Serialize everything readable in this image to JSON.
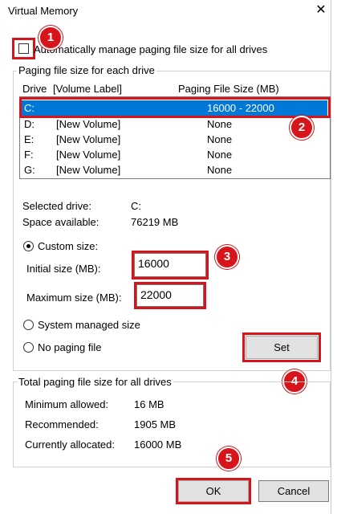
{
  "window": {
    "title": "Virtual Memory",
    "close_glyph": "✕"
  },
  "auto_manage": {
    "label": "Automatically manage paging file size for all drives",
    "checked": false
  },
  "paging_group": {
    "legend": "Paging file size for each drive",
    "columns": [
      "Drive",
      "[Volume Label]",
      "Paging File Size (MB)"
    ],
    "rows": [
      {
        "drive": "C:",
        "label": "",
        "size": "16000 - 22000",
        "selected": true
      },
      {
        "drive": "D:",
        "label": "[New Volume]",
        "size": "None",
        "selected": false
      },
      {
        "drive": "E:",
        "label": "[New Volume]",
        "size": "None",
        "selected": false
      },
      {
        "drive": "F:",
        "label": "[New Volume]",
        "size": "None",
        "selected": false
      },
      {
        "drive": "G:",
        "label": "[New Volume]",
        "size": "None",
        "selected": false
      }
    ],
    "selected_drive_label": "Selected drive:",
    "selected_drive_value": "C:",
    "space_available_label": "Space available:",
    "space_available_value": "76219 MB",
    "custom_size_label": "Custom size:",
    "initial_size_label": "Initial size (MB):",
    "initial_size_value": "16000",
    "maximum_size_label": "Maximum size (MB):",
    "maximum_size_value": "22000",
    "system_managed_label": "System managed size",
    "no_paging_label": "No paging file",
    "set_label": "Set",
    "selected_option": "custom"
  },
  "total_group": {
    "legend": "Total paging file size for all drives",
    "minimum_label": "Minimum allowed:",
    "minimum_value": "16 MB",
    "recommended_label": "Recommended:",
    "recommended_value": "1905 MB",
    "allocated_label": "Currently allocated:",
    "allocated_value": "16000 MB"
  },
  "buttons": {
    "ok": "OK",
    "cancel": "Cancel"
  },
  "annotations": [
    "1",
    "2",
    "3",
    "4",
    "5"
  ],
  "colors": {
    "highlight": "#0078d7",
    "annotation_red": "#d6141a"
  }
}
